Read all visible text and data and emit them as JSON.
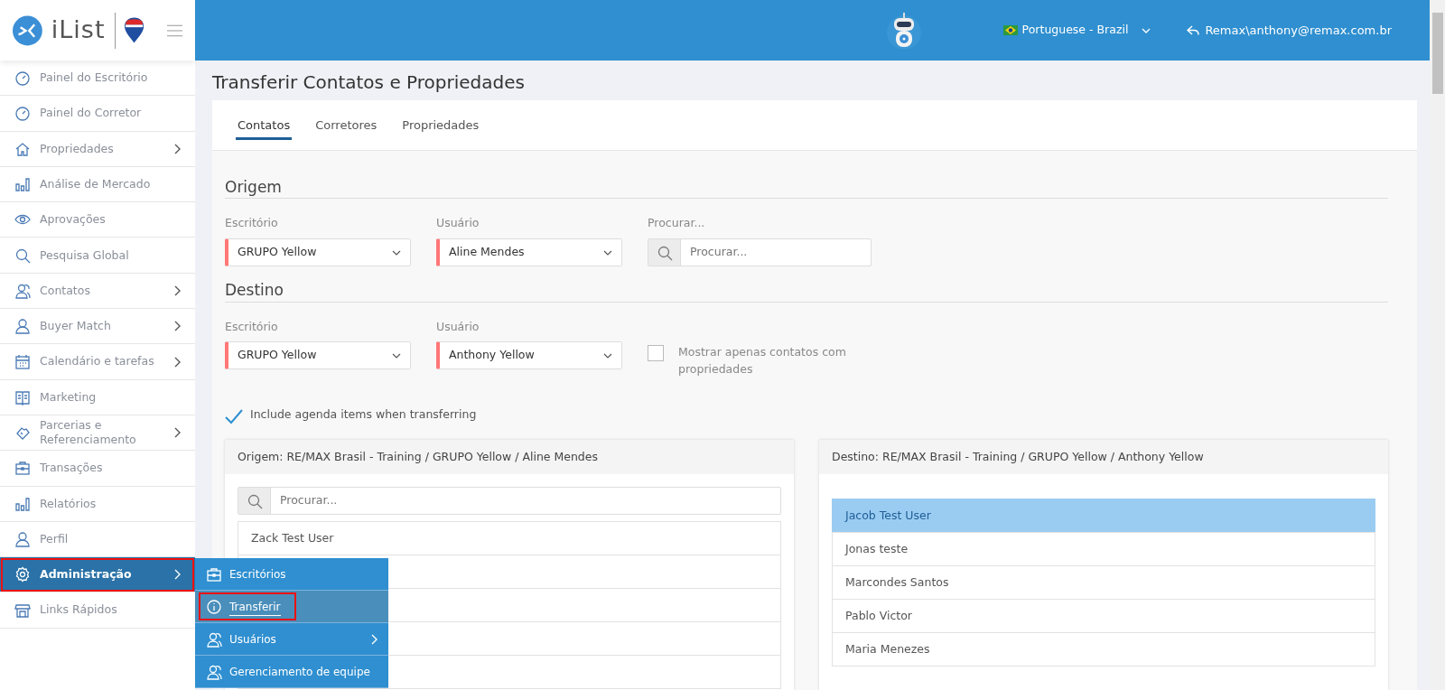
{
  "app": {
    "logo_text": "iList"
  },
  "header": {
    "language": "Portuguese - Brazil",
    "user": "Remax\\anthony@remax.com.br"
  },
  "sidebar": {
    "items": [
      {
        "label": "Painel do Escritório",
        "has_submenu": false,
        "selected": false,
        "annotated": false
      },
      {
        "label": "Painel do Corretor",
        "has_submenu": false,
        "selected": false,
        "annotated": false
      },
      {
        "label": "Propriedades",
        "has_submenu": true,
        "selected": false,
        "annotated": false
      },
      {
        "label": "Análise de Mercado",
        "has_submenu": false,
        "selected": false,
        "annotated": false
      },
      {
        "label": "Aprovações",
        "has_submenu": false,
        "selected": false,
        "annotated": false
      },
      {
        "label": "Pesquisa Global",
        "has_submenu": false,
        "selected": false,
        "annotated": false
      },
      {
        "label": "Contatos",
        "has_submenu": true,
        "selected": false,
        "annotated": false
      },
      {
        "label": "Buyer Match",
        "has_submenu": true,
        "selected": false,
        "annotated": false
      },
      {
        "label": "Calendário e tarefas",
        "has_submenu": true,
        "selected": false,
        "annotated": false
      },
      {
        "label": "Marketing",
        "has_submenu": false,
        "selected": false,
        "annotated": false
      },
      {
        "label": "Parcerias e Referenciamento",
        "has_submenu": true,
        "selected": false,
        "annotated": false
      },
      {
        "label": "Transações",
        "has_submenu": false,
        "selected": false,
        "annotated": false
      },
      {
        "label": "Relatórios",
        "has_submenu": false,
        "selected": false,
        "annotated": false
      },
      {
        "label": "Perfil",
        "has_submenu": false,
        "selected": false,
        "annotated": false
      },
      {
        "label": "Administração",
        "has_submenu": true,
        "selected": true,
        "annotated": true
      },
      {
        "label": "Links Rápidos",
        "has_submenu": false,
        "selected": false,
        "annotated": false
      }
    ]
  },
  "submenu": {
    "items": [
      {
        "label": "Escritórios",
        "has_submenu": false,
        "selected": false,
        "annotated": false
      },
      {
        "label": "Transferir",
        "has_submenu": false,
        "selected": true,
        "annotated": true
      },
      {
        "label": "Usuários",
        "has_submenu": true,
        "selected": false,
        "annotated": false
      },
      {
        "label": "Gerenciamento de equipe",
        "has_submenu": false,
        "selected": false,
        "annotated": false
      }
    ]
  },
  "page": {
    "title": "Transferir Contatos e Propriedades",
    "tabs": [
      {
        "label": "Contatos",
        "selected": true
      },
      {
        "label": "Corretores",
        "selected": false
      },
      {
        "label": "Propriedades",
        "selected": false
      }
    ],
    "sections": [
      {
        "heading": "Origem",
        "fields": [
          {
            "kind": "select",
            "label": "Escritório",
            "value": "GRUPO Yellow"
          },
          {
            "kind": "select",
            "label": "Usuário",
            "value": "Aline Mendes"
          },
          {
            "kind": "search",
            "label": "Procurar...",
            "placeholder": "Procurar..."
          }
        ]
      },
      {
        "heading": "Destino",
        "fields": [
          {
            "kind": "select",
            "label": "Escritório",
            "value": "GRUPO Yellow"
          },
          {
            "kind": "select",
            "label": "Usuário",
            "value": "Anthony Yellow"
          },
          {
            "kind": "checkbox",
            "label": "Mostrar apenas contatos com propriedades",
            "checked": false
          }
        ]
      }
    ],
    "include_agenda": {
      "label": "Include agenda items when transferring",
      "checked": true
    },
    "panels": [
      {
        "title": "Origem: RE/MAX Brasil - Training / GRUPO Yellow / Aline Mendes",
        "search_placeholder": "Procurar...",
        "rows": [
          {
            "label": "Zack Test User",
            "selected": false
          },
          {
            "selected": false
          },
          {
            "selected": false
          },
          {
            "selected": false
          },
          {
            "selected": false
          }
        ]
      },
      {
        "title": "Destino: RE/MAX Brasil - Training / GRUPO Yellow / Anthony Yellow",
        "rows": [
          {
            "label": "Jacob Test User",
            "selected": true
          },
          {
            "label": "Jonas teste",
            "selected": false
          },
          {
            "label": "Marcondes Santos",
            "selected": false
          },
          {
            "label": "Pablo Victor",
            "selected": false
          },
          {
            "label": "Maria Menezes",
            "selected": false
          }
        ]
      }
    ]
  }
}
